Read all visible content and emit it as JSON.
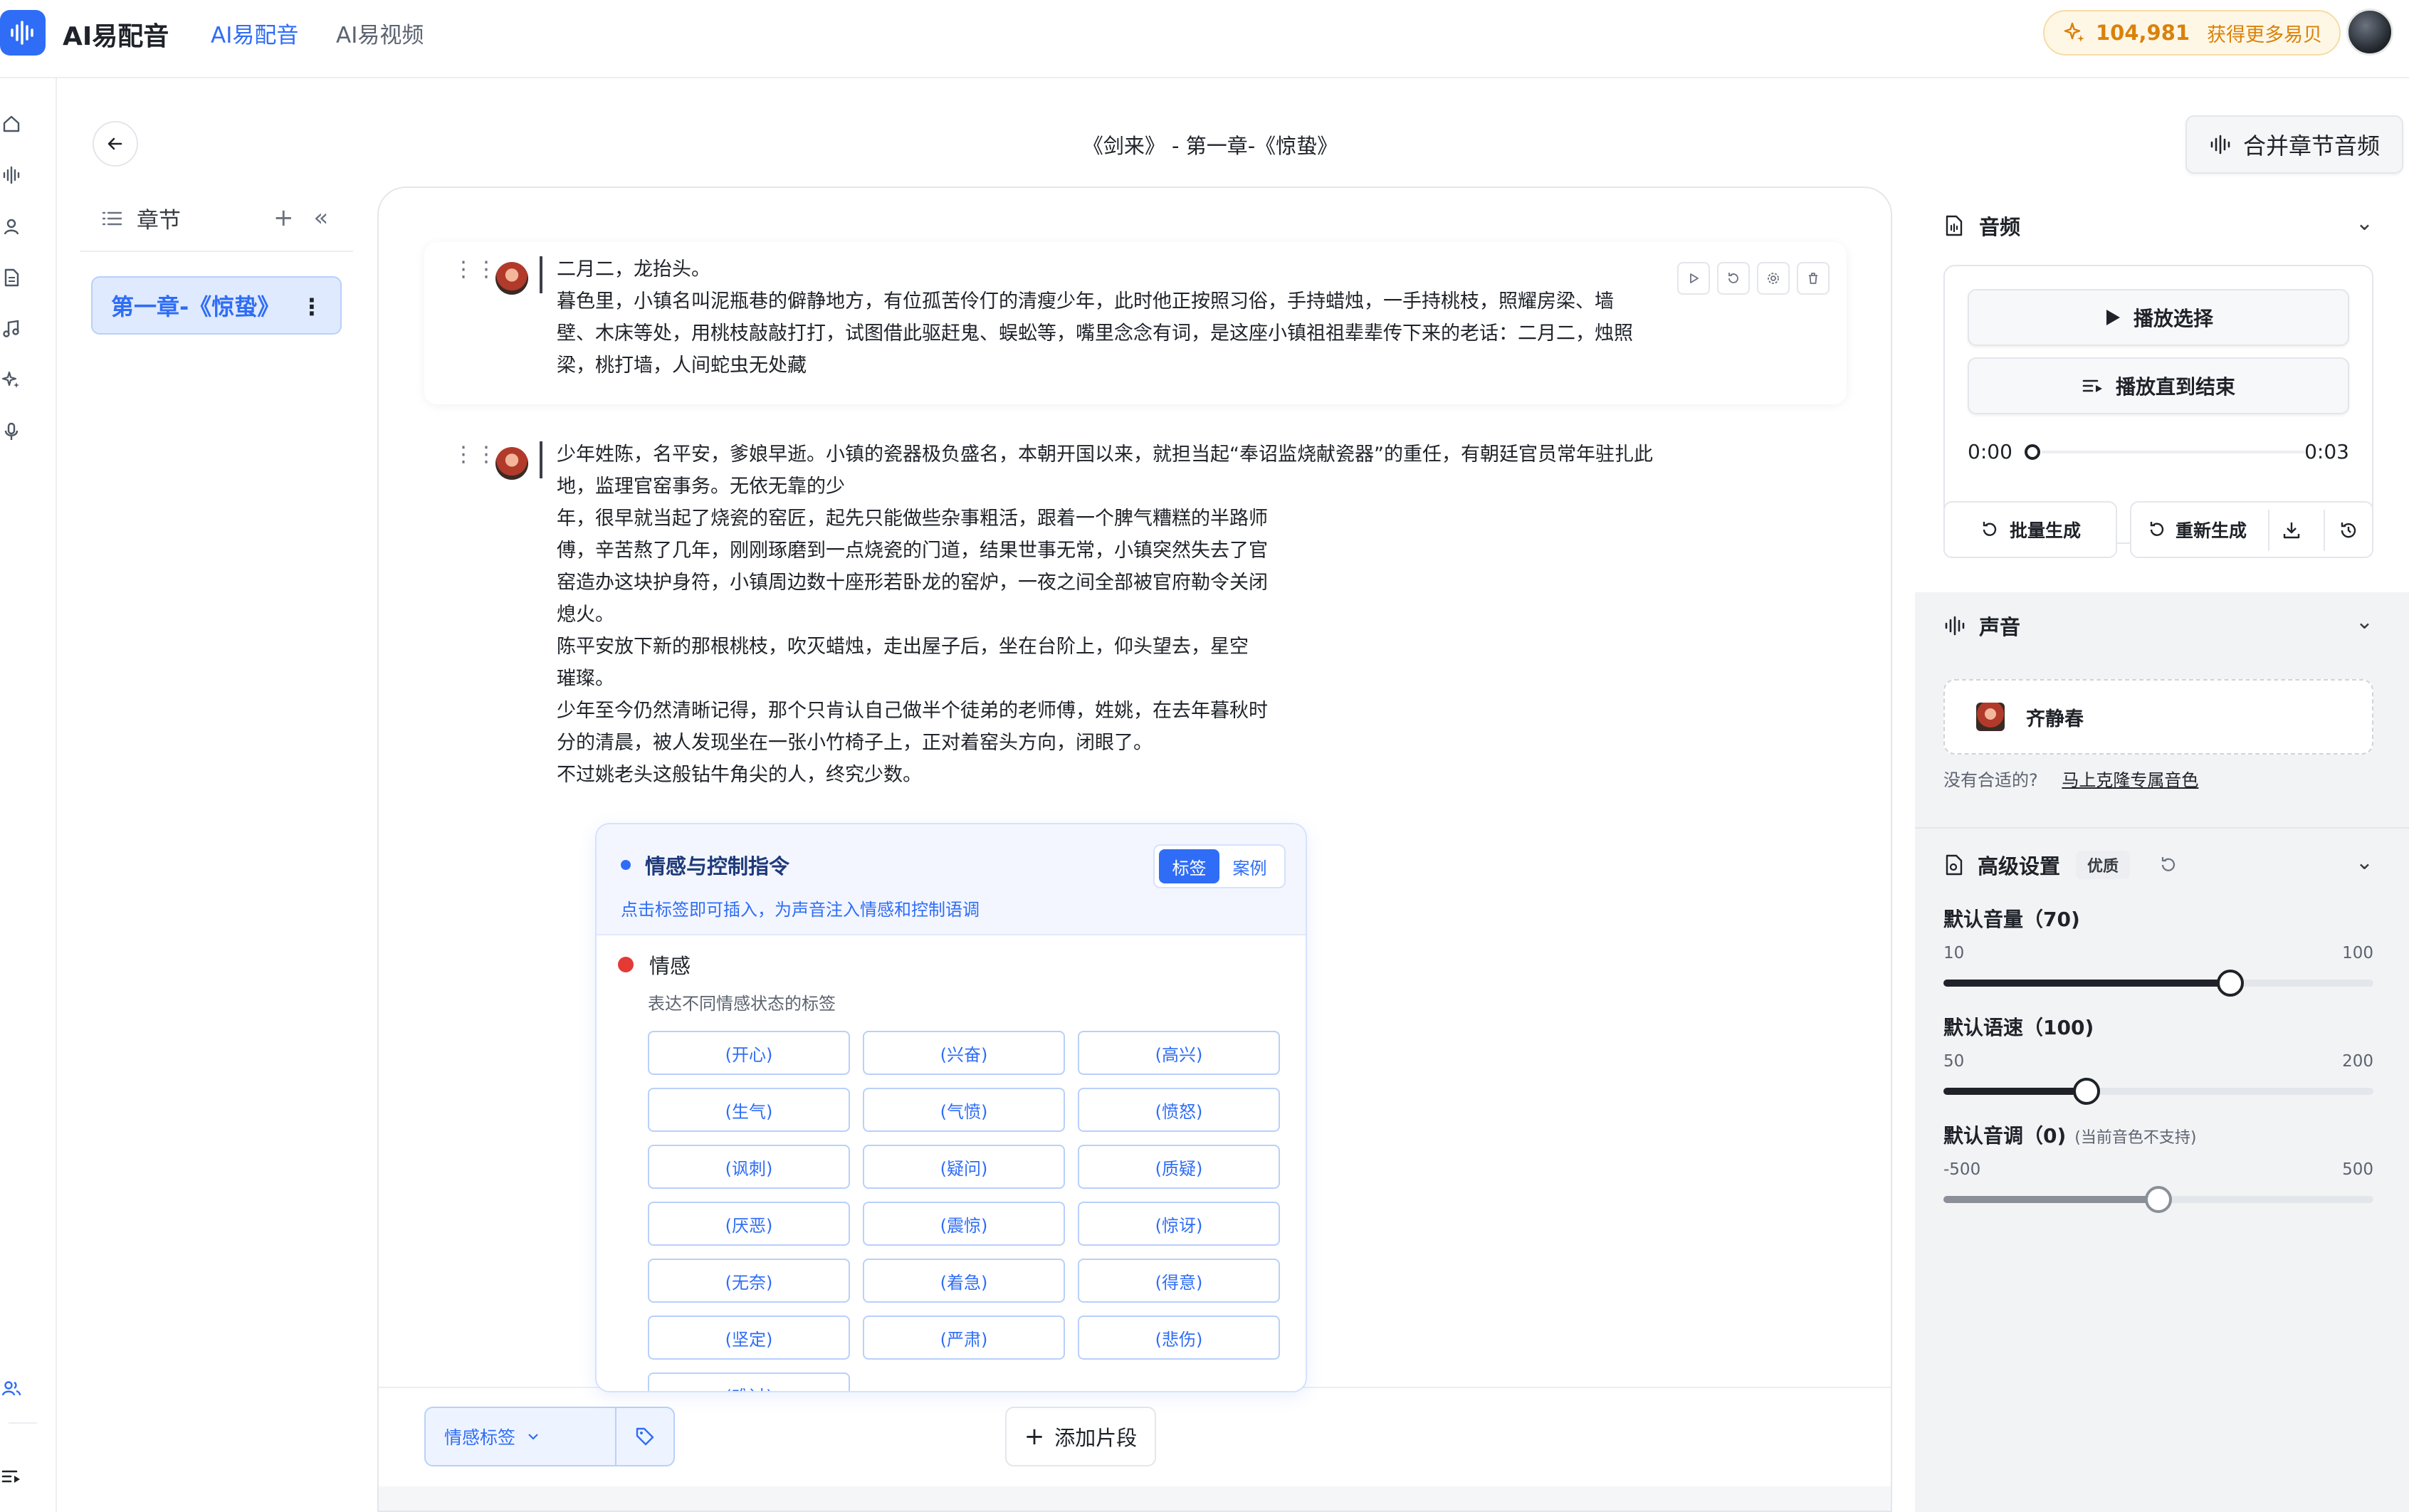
{
  "topbar": {
    "app_name": "AI易配音",
    "nav": [
      "AI易配音",
      "AI易视频"
    ],
    "credits": "104,981",
    "get_more": "获得更多易贝"
  },
  "header": {
    "title": "《剑来》 - 第一章-《惊蛰》",
    "merge_label": "合并章节音频"
  },
  "chapters": {
    "heading": "章节",
    "items": [
      {
        "label": "第一章-《惊蛰》"
      }
    ]
  },
  "paragraphs": [
    {
      "text": "二月二，龙抬头。\n暮色里，小镇名叫泥瓶巷的僻静地方，有位孤苦伶仃的清瘦少年，此时他正按照习俗，手持蜡烛，一手持桃枝，照耀房梁、墙壁、木床等处，用桃枝敲敲打打，试图借此驱赶鬼、蜈蚣等，嘴里念念有词，是这座小镇祖祖辈辈传下来的老话：二月二，烛照梁，桃打墙，人间蛇虫无处藏"
    },
    {
      "text": "少年姓陈，名平安，爹娘早逝。小镇的瓷器极负盛名，本朝开国以来，就担当起“奉诏监烧献瓷器”的重任，有朝廷官员常年驻扎此地，监理官窑事务。无依无靠的少\n年，很早就当起了烧瓷的窑匠，起先只能做些杂事粗活，跟着一个脾气糟糕的半路师\n傅，辛苦熬了几年，刚刚琢磨到一点烧瓷的门道，结果世事无常，小镇突然失去了官\n窑造办这块护身符，小镇周边数十座形若卧龙的窑炉，一夜之间全部被官府勒令关闭\n熄火。\n陈平安放下新的那根桃枝，吹灭蜡烛，走出屋子后，坐在台阶上，仰头望去，星空\n璀璨。\n少年至今仍然清晰记得，那个只肯认自己做半个徒弟的老师傅，姓姚，在去年暮秋时\n分的清晨，被人发现坐在一张小竹椅子上，正对着窑头方向，闭眼了。\n不过姚老头这般钻牛角尖的人，终究少数。"
    }
  ],
  "emotion_panel": {
    "title": "情感与控制指令",
    "subtitle": "点击标签即可插入，为声音注入情感和控制语调",
    "tab_tags": "标签",
    "tab_cases": "案例",
    "section_title": "情感",
    "section_desc": "表达不同情感状态的标签",
    "tags": [
      "(开心)",
      "(兴奋)",
      "(高兴)",
      "(生气)",
      "(气愤)",
      "(愤怒)",
      "(讽刺)",
      "(疑问)",
      "(质疑)",
      "(厌恶)",
      "(震惊)",
      "(惊讶)",
      "(无奈)",
      "(着急)",
      "(得意)",
      "(坚定)",
      "(严肃)",
      "(悲伤)",
      "(难过)"
    ]
  },
  "bottom": {
    "emotion_dropdown": "情感标签",
    "add_segment": "添加片段"
  },
  "audio": {
    "heading": "音频",
    "play_selection": "播放选择",
    "play_to_end": "播放直到结束",
    "time_start": "0:00",
    "time_end": "0:03",
    "batch_generate": "批量生成",
    "regenerate": "重新生成"
  },
  "voice": {
    "heading": "声音",
    "name": "齐静春",
    "hint": "没有合适的?",
    "clone_link": "马上克隆专属音色"
  },
  "advanced": {
    "heading": "高级设置",
    "badge": "优质",
    "volume": {
      "label": "默认音量（70)",
      "min": "10",
      "max": "100",
      "value": 70,
      "range": [
        10,
        100
      ]
    },
    "speed": {
      "label": "默认语速（100)",
      "min": "50",
      "max": "200",
      "value": 100,
      "range": [
        50,
        200
      ]
    },
    "pitch": {
      "label": "默认音调（0)",
      "note": "(当前音色不支持)",
      "min": "-500",
      "max": "500",
      "value": 0,
      "range": [
        -500,
        500
      ]
    }
  },
  "colors": {
    "accent": "#2f6df6",
    "credit": "#d9820b",
    "emotion_dot": "#e53935"
  }
}
